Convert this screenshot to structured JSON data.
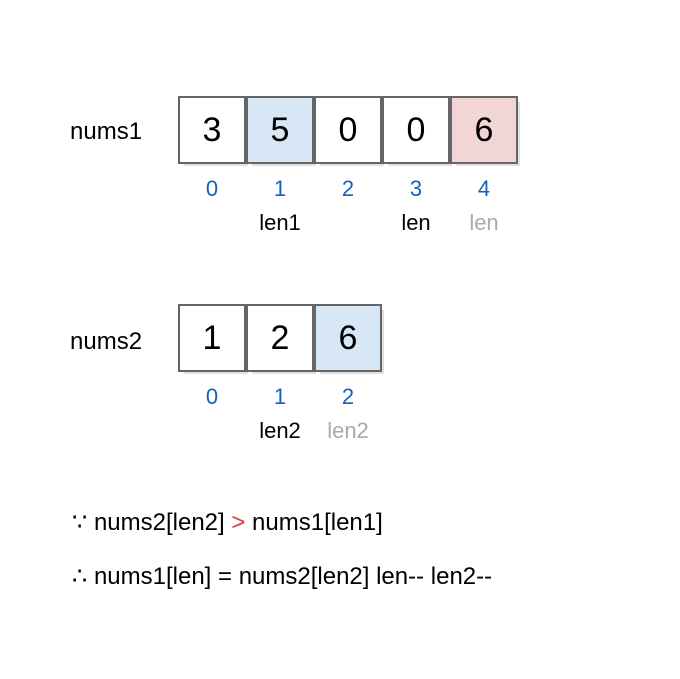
{
  "nums1": {
    "label": "nums1",
    "cells": [
      {
        "v": "3",
        "hl": ""
      },
      {
        "v": "5",
        "hl": "blue"
      },
      {
        "v": "0",
        "hl": ""
      },
      {
        "v": "0",
        "hl": ""
      },
      {
        "v": "6",
        "hl": "pink"
      }
    ],
    "indices": [
      "0",
      "1",
      "2",
      "3",
      "4"
    ],
    "pointers": [
      {
        "col": 1,
        "text": "len1",
        "faded": false
      },
      {
        "col": 3,
        "text": "len",
        "faded": false
      },
      {
        "col": 4,
        "text": "len",
        "faded": true
      }
    ]
  },
  "nums2": {
    "label": "nums2",
    "cells": [
      {
        "v": "1",
        "hl": ""
      },
      {
        "v": "2",
        "hl": ""
      },
      {
        "v": "6",
        "hl": "blue"
      }
    ],
    "indices": [
      "0",
      "1",
      "2"
    ],
    "pointers": [
      {
        "col": 1,
        "text": "len2",
        "faded": false
      },
      {
        "col": 2,
        "text": "len2",
        "faded": true
      }
    ]
  },
  "statements": {
    "line1_prefix": "∵ nums2[len2] ",
    "line1_op": ">",
    "line1_suffix": " nums1[len1]",
    "line2": "∴ nums1[len] = nums2[len2]   len-- len2--"
  }
}
